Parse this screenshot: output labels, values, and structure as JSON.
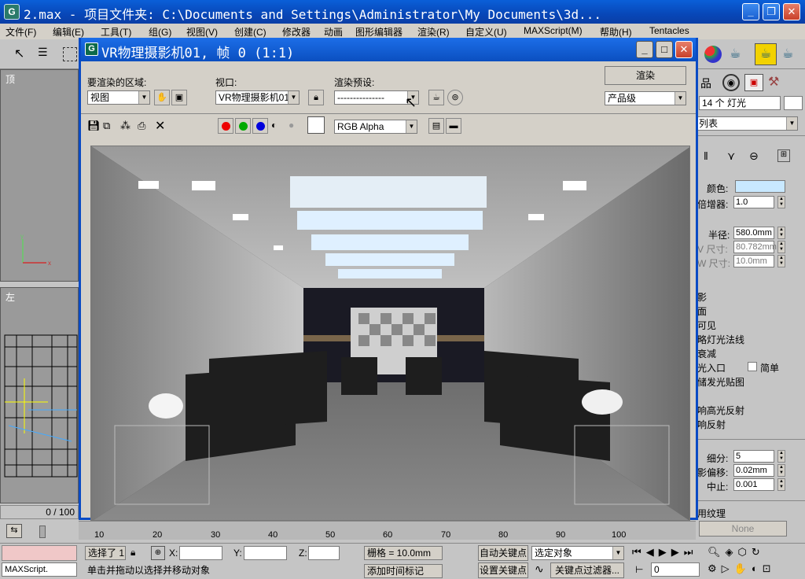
{
  "window": {
    "title": "2.max    - 项目文件夹: C:\\Documents and Settings\\Administrator\\My Documents\\3d..."
  },
  "menu": [
    "文件(F)",
    "编辑(E)",
    "工具(T)",
    "组(G)",
    "视图(V)",
    "创建(C)",
    "修改器",
    "动画",
    "图形编辑器",
    "渲染(R)",
    "自定义(U)",
    "MAXScript(M)",
    "帮助(H)",
    "Tentacles"
  ],
  "viewports": {
    "top_label": "顶",
    "left_label": "左"
  },
  "vfb": {
    "title": "VR物理摄影机01, 帧 0 (1:1)",
    "area_label": "要渲染的区域:",
    "area_value": "视图",
    "viewport_label": "视口:",
    "viewport_value": "VR物理摄影机01",
    "preset_label": "渲染预设:",
    "preset_value": "---------------",
    "render_button": "渲染",
    "quality_value": "产品级",
    "channel_value": "RGB Alpha"
  },
  "cmdpanel": {
    "object_count": "14 个 灯光",
    "list_label": "列表",
    "color_label": "颜色:",
    "multiplier_label": "倍增器:",
    "multiplier_value": "1.0",
    "radius_label": "半径:",
    "radius_value": "580.0mm",
    "vsize_label": "V 尺寸:",
    "vsize_value": "80.782mm",
    "wsize_label": "W 尺寸:",
    "wsize_value": "10.0mm",
    "options": [
      "影",
      "面",
      "可见",
      "略灯光法线",
      "衰减",
      "光入口",
      "储发光贴图",
      "响高光反射",
      "响反射"
    ],
    "simple_label": "简单",
    "subdivs_label": "细分:",
    "subdivs_value": "5",
    "bias_label": "影偏移:",
    "bias_value": "0.02mm",
    "cutoff_label": "中止:",
    "cutoff_value": "0.001",
    "texture_label": "用纹理",
    "texture_value": "None"
  },
  "timeline": {
    "frame_counter": "0 / 100",
    "ticks": [
      "10",
      "20",
      "30",
      "40",
      "50",
      "60",
      "70",
      "80",
      "90",
      "100"
    ]
  },
  "status": {
    "selected": "选择了 1",
    "x_label": "X:",
    "y_label": "Y:",
    "z_label": "Z:",
    "grid": "栅格 = 10.0mm",
    "auto_key": "自动关键点",
    "selected_obj": "选定对象",
    "set_key": "设置关键点",
    "key_filter": "关键点过滤器...",
    "frame_value": "0",
    "maxscript": "MAXScript.",
    "prompt": "单击并拖动以选择并移动对象",
    "add_time_tag": "添加时间标记"
  }
}
